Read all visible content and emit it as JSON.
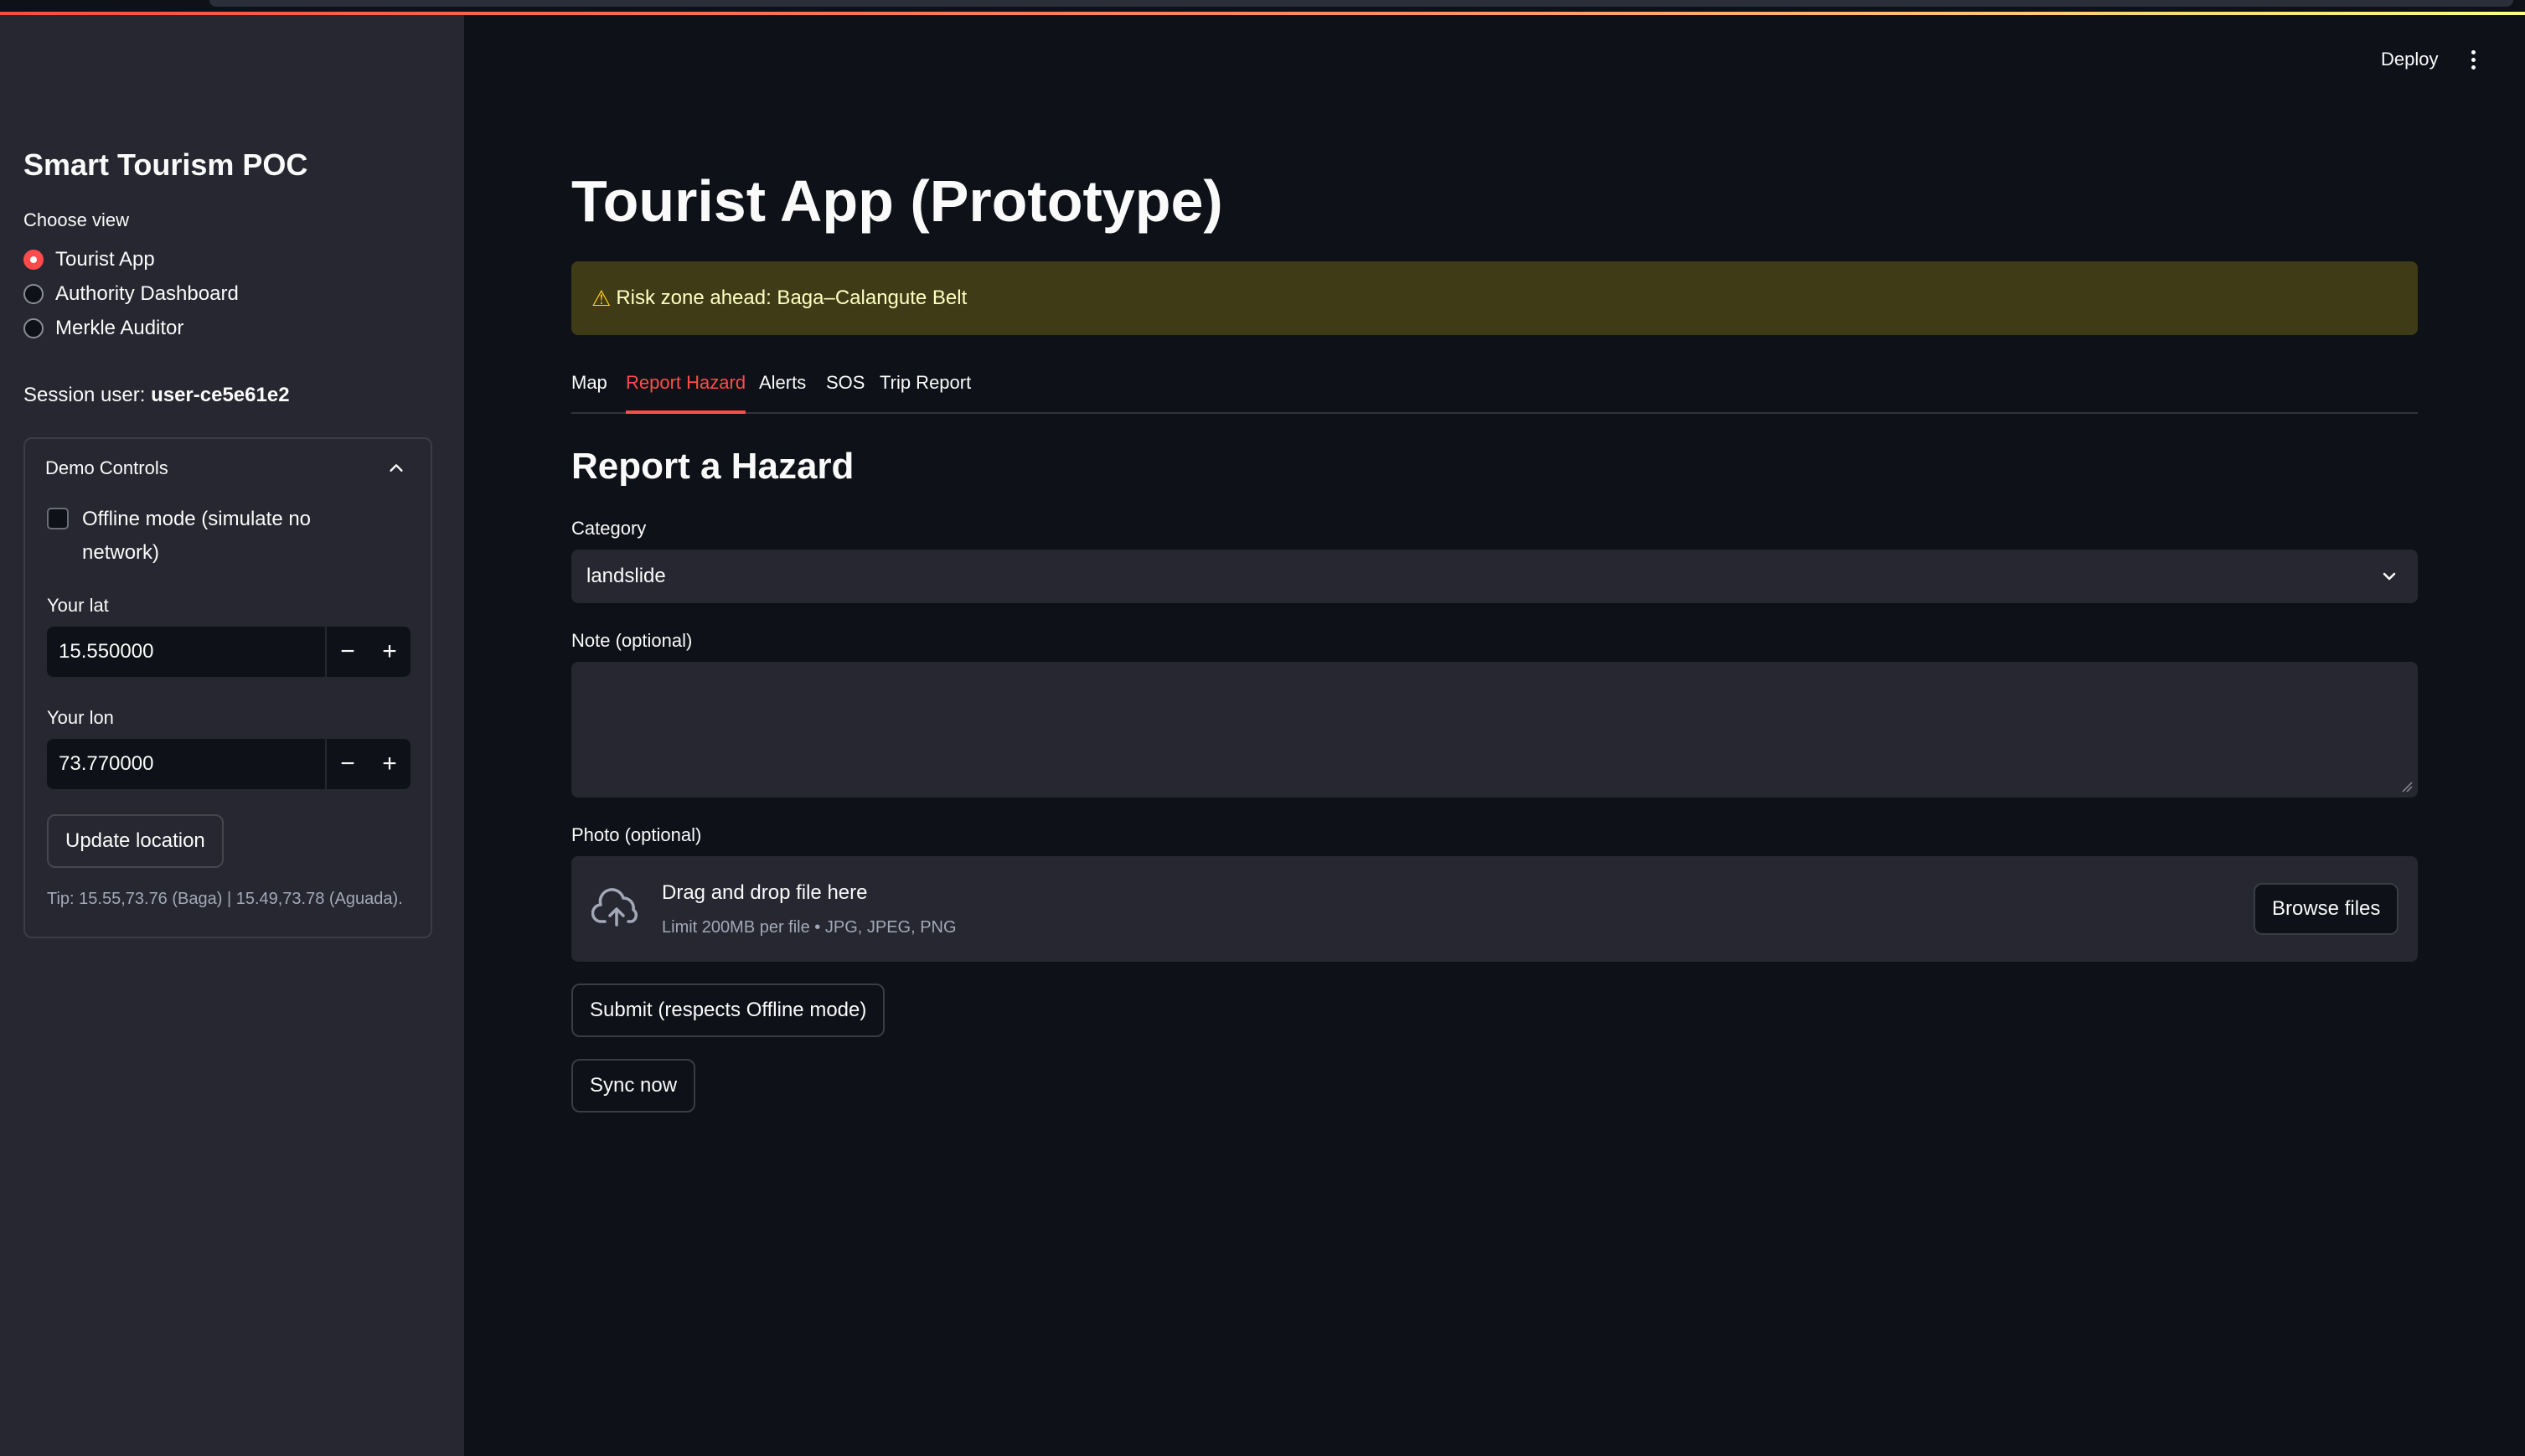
{
  "sidebar": {
    "title": "Smart Tourism POC",
    "choose_label": "Choose view",
    "views": [
      {
        "label": "Tourist App",
        "selected": true
      },
      {
        "label": "Authority Dashboard",
        "selected": false
      },
      {
        "label": "Merkle Auditor",
        "selected": false
      }
    ],
    "session_prefix": "Session user: ",
    "session_user": "user-ce5e61e2",
    "demo_controls": {
      "title": "Demo Controls",
      "expanded": true,
      "offline_label": "Offline mode (simulate no network)",
      "offline_checked": false,
      "lat_label": "Your lat",
      "lat_value": "15.550000",
      "lon_label": "Your lon",
      "lon_value": "73.770000",
      "update_button": "Update location",
      "tip": "Tip: 15.55,73.76 (Baga) | 15.49,73.78 (Aguada)."
    }
  },
  "header": {
    "deploy": "Deploy"
  },
  "main": {
    "title": "Tourist App (Prototype)",
    "alert": {
      "icon": "warning-icon",
      "text": "Risk zone ahead: Baga–Calangute Belt",
      "color": "#3e3b16"
    },
    "tabs": [
      {
        "label": "Map",
        "active": false
      },
      {
        "label": "Report Hazard",
        "active": true
      },
      {
        "label": "Alerts",
        "active": false
      },
      {
        "label": "SOS",
        "active": false
      },
      {
        "label": "Trip Report",
        "active": false
      }
    ],
    "section_title": "Report a Hazard",
    "category": {
      "label": "Category",
      "value": "landslide"
    },
    "note": {
      "label": "Note (optional)",
      "value": ""
    },
    "photo": {
      "label": "Photo (optional)",
      "drop_title": "Drag and drop file here",
      "drop_sub": "Limit 200MB per file • JPG, JPEG, PNG",
      "browse": "Browse files"
    },
    "submit_button": "Submit (respects Offline mode)",
    "sync_button": "Sync now"
  },
  "colors": {
    "accent": "#ff4b4b",
    "background": "#0e1117",
    "sidebar": "#262730"
  }
}
